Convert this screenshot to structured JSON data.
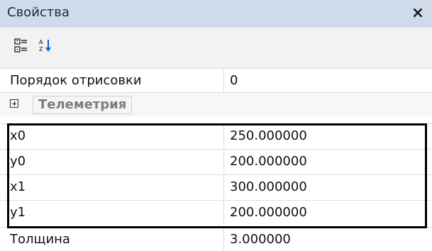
{
  "window": {
    "title": "Свойства",
    "close_symbol": "×",
    "toolbar": {
      "categorized_icon": "categorized-view-icon",
      "alphabetical_icon": "alphabetical-sort-icon"
    }
  },
  "properties": {
    "draw_order": {
      "label": "Порядок отрисовки",
      "value": "0"
    },
    "telemetry_category": {
      "label": "Телеметрия"
    },
    "x0": {
      "label": "x0",
      "value": "250.000000"
    },
    "y0": {
      "label": "y0",
      "value": "200.000000"
    },
    "x1": {
      "label": "x1",
      "value": "300.000000"
    },
    "y1": {
      "label": "y1",
      "value": "200.000000"
    },
    "thickness": {
      "label": "Толщина",
      "value": "3.000000"
    }
  },
  "colors": {
    "title_bar": "#cfdbea",
    "toolbar_bg": "#f2f2f2",
    "grid_lines": "#dcdcdc",
    "category_text": "#7c7c7c",
    "highlight_border": "#000000"
  }
}
